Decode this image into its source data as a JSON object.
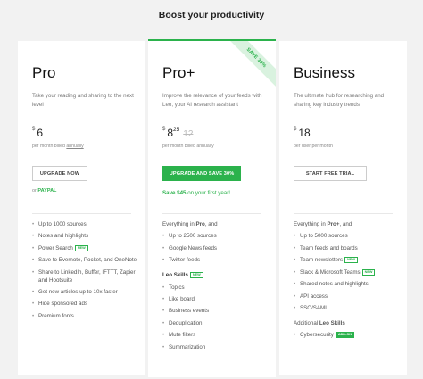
{
  "page": {
    "heading": "Boost your productivity"
  },
  "pro": {
    "name": "Pro",
    "desc": "Take your reading and sharing to the next level",
    "currency": "$",
    "price": "6",
    "price_note_prefix": "per month billed ",
    "price_note_link": "annually",
    "button": "UPGRADE NOW",
    "or_prefix": "or ",
    "or_method": "PAYPAL",
    "features": [
      "Up to 1000 sources",
      "Notes and highlights",
      "Power Search",
      "Save to Evernote, Pocket, and OneNote",
      "Share to LinkedIn, Buffer, IFTTT, Zapier and Hootsuite",
      "Get new articles up to 10x faster",
      "Hide sponsored ads",
      "Premium fonts"
    ],
    "power_search_tag": "NEW"
  },
  "plus": {
    "ribbon": "SAVE 30%",
    "name": "Pro+",
    "desc": "Improve the relevance of your feeds with Leo, your AI research assistant",
    "currency": "$",
    "price": "8",
    "cents": "25",
    "old_price": "12",
    "old_cents": "",
    "price_note": "per month billed annually",
    "button": "UPGRADE AND SAVE 30%",
    "save_prefix": "Save $45",
    "save_suffix": " on your first year!",
    "intro_prefix": "Everything in ",
    "intro_bold": "Pro",
    "intro_suffix": ", and",
    "features": [
      "Up to 2500 sources",
      "Google News feeds",
      "Twitter feeds"
    ],
    "skills_title": "Leo Skills",
    "skills_tag": "NEW",
    "skills": [
      "Topics",
      "Like board",
      "Business events",
      "Deduplication",
      "Mute filters",
      "Summarization"
    ]
  },
  "biz": {
    "name": "Business",
    "desc": "The ultimate hub for researching and sharing key industry trends",
    "currency": "$",
    "price": "18",
    "price_note": "per user per month",
    "button": "START FREE TRIAL",
    "intro_prefix": "Everything in ",
    "intro_bold": "Pro+",
    "intro_suffix": ", and",
    "features": [
      "Up to 5000 sources",
      "Team feeds and boards",
      "Team newsletters",
      "Slack & Microsoft Teams",
      "Shared notes and highlights",
      "API access",
      "SSO/SAML"
    ],
    "newsletters_tag": "NEW",
    "slack_tag": "NEW",
    "additional_prefix": "Additional ",
    "additional_bold": "Leo Skills",
    "skills": [
      "Cybersecurity"
    ],
    "cyber_tag": "ADD-ON"
  },
  "colors": {
    "accent": "#2bb24c",
    "background": "#f2f2f2"
  }
}
